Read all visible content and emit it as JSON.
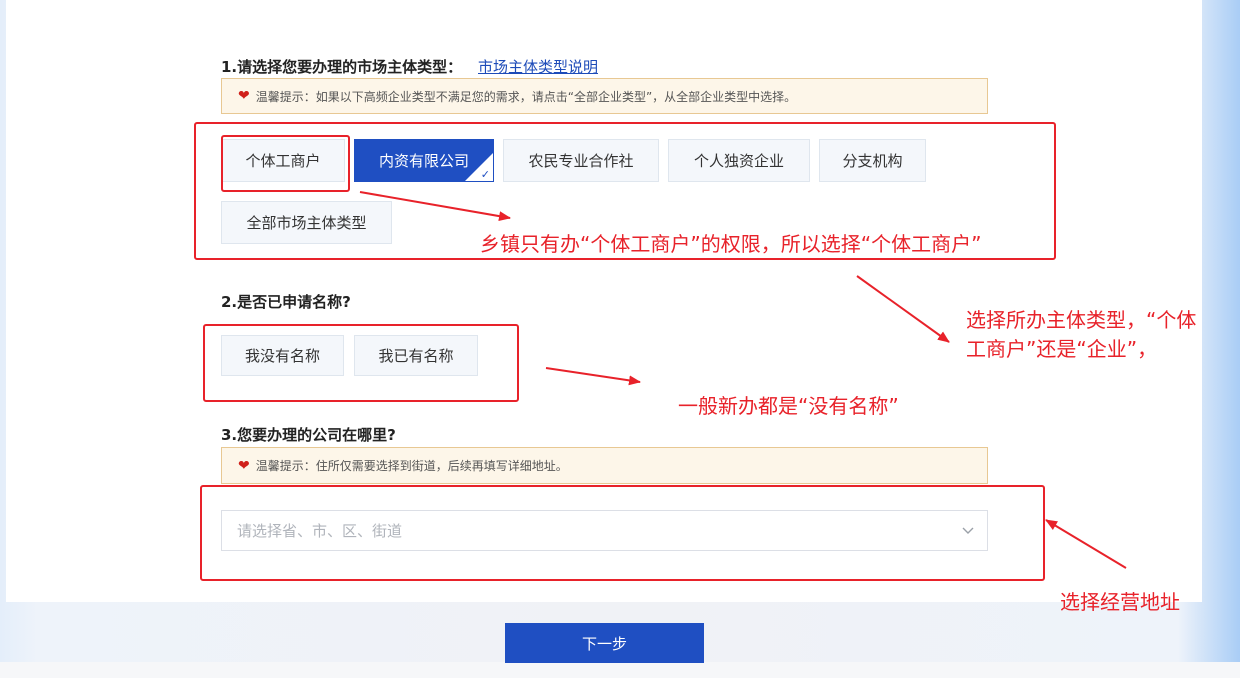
{
  "section1": {
    "title": "1.请选择您要办理的市场主体类型：",
    "link": "市场主体类型说明",
    "tip": "温馨提示：如果以下高频企业类型不满足您的需求，请点击“全部企业类型”，从全部企业类型中选择。",
    "options": [
      "个体工商户",
      "内资有限公司",
      "农民专业合作社",
      "个人独资企业",
      "分支机构",
      "全部市场主体类型"
    ],
    "selected": "内资有限公司"
  },
  "section2": {
    "title": "2.是否已申请名称?",
    "options": [
      "我没有名称",
      "我已有名称"
    ]
  },
  "section3": {
    "title": "3.您要办理的公司在哪里?",
    "tip": "温馨提示：住所仅需要选择到街道，后续再填写详细地址。",
    "select_placeholder": "请选择省、市、区、街道"
  },
  "next_button": "下一步",
  "annotations": {
    "a1": "乡镇只有办“个体工商户”的权限，所以选择“个体工商户”",
    "a2_line1": "选择所办主体类型，“个体",
    "a2_line2": "工商户”还是“企业”，",
    "a3": "一般新办都是“没有名称”",
    "a4": "选择经营地址"
  },
  "colors": {
    "primary": "#1f4fc2",
    "annotation_red": "#e8222a",
    "tip_background": "#fdf6e9",
    "tip_border": "#e8c893"
  },
  "icons": {
    "tip": "heart-icon",
    "select": "chevron-down-icon",
    "selected_marker": "check-icon"
  }
}
